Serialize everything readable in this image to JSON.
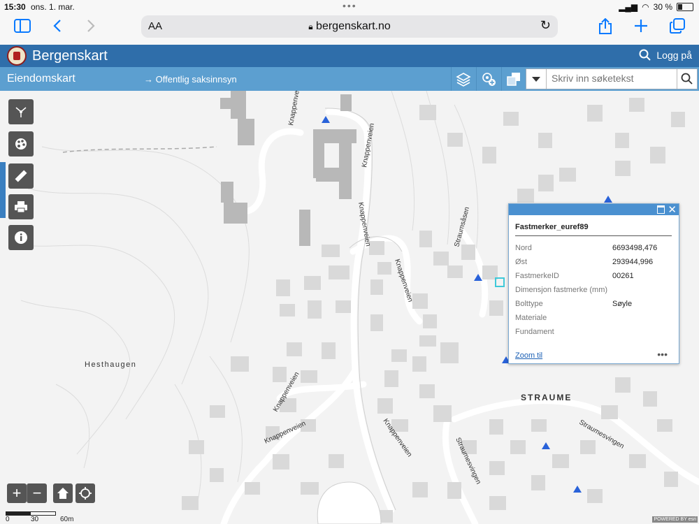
{
  "status_bar": {
    "time": "15:30",
    "date": "ons. 1. mar.",
    "battery": "30 %"
  },
  "browser": {
    "text_size_label": "AA",
    "url": "bergenskart.no"
  },
  "app": {
    "title": "Bergenskart",
    "login_label": "Logg på"
  },
  "subbar": {
    "title": "Eiendomskart",
    "saksinnsyn_link": "→ Offentlig saksinnsyn",
    "search_placeholder": "Skriv inn søketekst"
  },
  "map": {
    "place_labels": {
      "hesthaugen": "Hesthaugen",
      "straume": "STRAUME"
    },
    "road_labels": {
      "knappenveien_1": "Knappenveien",
      "knappenveien_2": "Knappenveien",
      "knappenveien_3": "Knappenveien",
      "knappenveien_4": "Knappenveien",
      "knappenveien_5": "Knappenveien",
      "knappenveien_6": "Knappenveien",
      "knappenveien_7": "Knappenveien",
      "straumsasen": "Straumsåsen",
      "straumesvingen_1": "Straumesvingen",
      "straumesvingen_2": "Straumesvingen"
    },
    "scale": {
      "label_0": "0",
      "label_30": "30",
      "label_60": "60m"
    },
    "powered_by": "POWERED BY esri",
    "zoom_in": "+",
    "zoom_out": "−"
  },
  "popup": {
    "title": "Fastmerker_euref89",
    "rows": [
      {
        "key": "Nord",
        "value": "6693498,476"
      },
      {
        "key": "Øst",
        "value": "293944,996"
      },
      {
        "key": "FastmerkeID",
        "value": "00261"
      },
      {
        "key": "Dimensjon fastmerke (mm)",
        "value": ""
      },
      {
        "key": "Bolttype",
        "value": "Søyle"
      },
      {
        "key": "Materiale",
        "value": ""
      },
      {
        "key": "Fundament",
        "value": ""
      }
    ],
    "zoom_label": "Zoom til",
    "more_label": "•••"
  },
  "colors": {
    "header": "#2f6eaa",
    "subheader": "#5c9fd0",
    "popup_header": "#4a90d0",
    "marker": "#2962d9",
    "map_background": "#f3f3f3"
  }
}
